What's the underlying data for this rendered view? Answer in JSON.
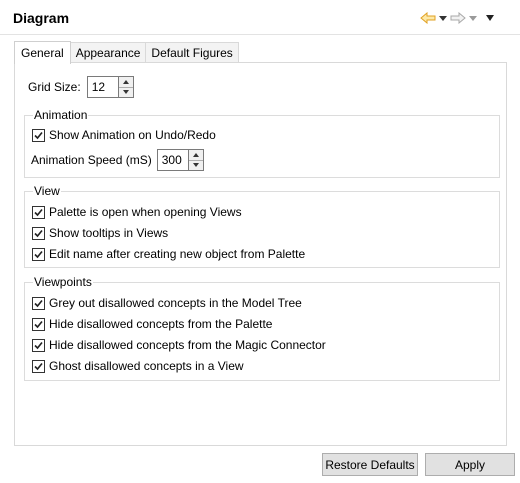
{
  "header": {
    "title": "Diagram",
    "back_icon": "back-arrow-icon",
    "forward_icon": "forward-arrow-icon",
    "menu_icon": "view-menu-icon",
    "back_color": "#e8b040",
    "forward_color": "#b0b0b0"
  },
  "tabs": [
    {
      "label": "General",
      "active": true
    },
    {
      "label": "Appearance",
      "active": false
    },
    {
      "label": "Default Figures",
      "active": false
    }
  ],
  "grid": {
    "label": "Grid Size:",
    "value": "12"
  },
  "animation": {
    "legend": "Animation",
    "show_label": "Show Animation on Undo/Redo",
    "show_checked": true,
    "speed_label": "Animation Speed (mS)",
    "speed_value": "300"
  },
  "view": {
    "legend": "View",
    "items": [
      {
        "label": "Palette is open when opening Views",
        "checked": true
      },
      {
        "label": "Show tooltips in Views",
        "checked": true
      },
      {
        "label": "Edit name after creating new object from Palette",
        "checked": true
      }
    ]
  },
  "viewpoints": {
    "legend": "Viewpoints",
    "items": [
      {
        "label": "Grey out disallowed concepts in the Model Tree",
        "checked": true
      },
      {
        "label": "Hide disallowed concepts from the Palette",
        "checked": true
      },
      {
        "label": "Hide disallowed concepts from the Magic Connector",
        "checked": true
      },
      {
        "label": "Ghost disallowed concepts in a View",
        "checked": true
      }
    ]
  },
  "buttons": {
    "restore_label": "Restore Defaults",
    "apply_label": "Apply"
  }
}
